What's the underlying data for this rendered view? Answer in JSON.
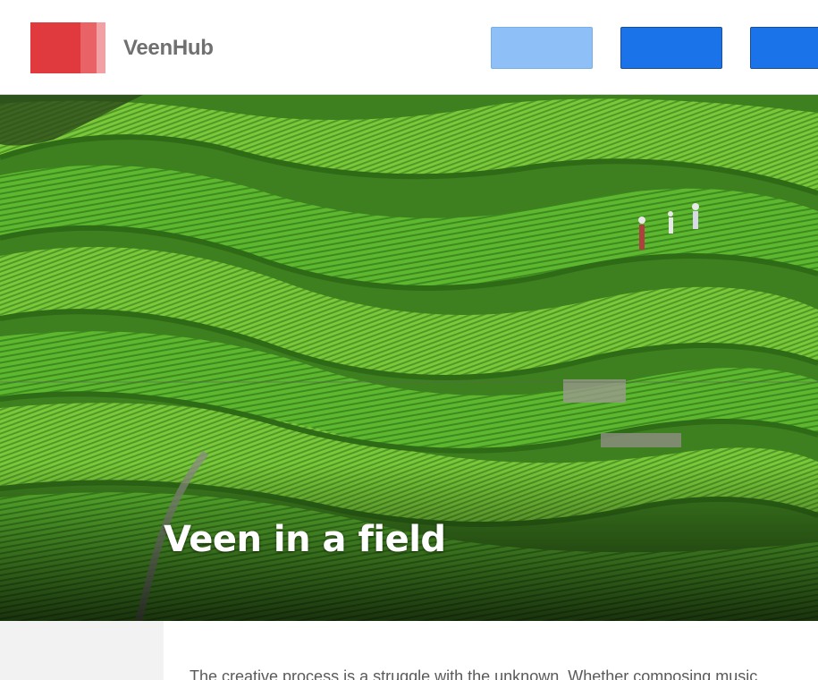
{
  "header": {
    "brand": "VeenHub",
    "logo_colors": [
      "#e0393e",
      "#e86266",
      "#f1a1a3"
    ],
    "nav_buttons": [
      {
        "label": "",
        "color": "#8fbff7"
      },
      {
        "label": "",
        "color": "#1a73e8"
      },
      {
        "label": "",
        "color": "#1a73e8"
      }
    ]
  },
  "hero": {
    "title": "Veen in a field",
    "image_subject": "terraced rice paddy field"
  },
  "article": {
    "intro": "The creative process is a struggle with the unknown. Whether composing music"
  },
  "colors": {
    "accent": "#1a73e8",
    "accent_light": "#8fbff7",
    "brand_red": "#e0393e",
    "sidebar_bg": "#f2f2f2"
  }
}
